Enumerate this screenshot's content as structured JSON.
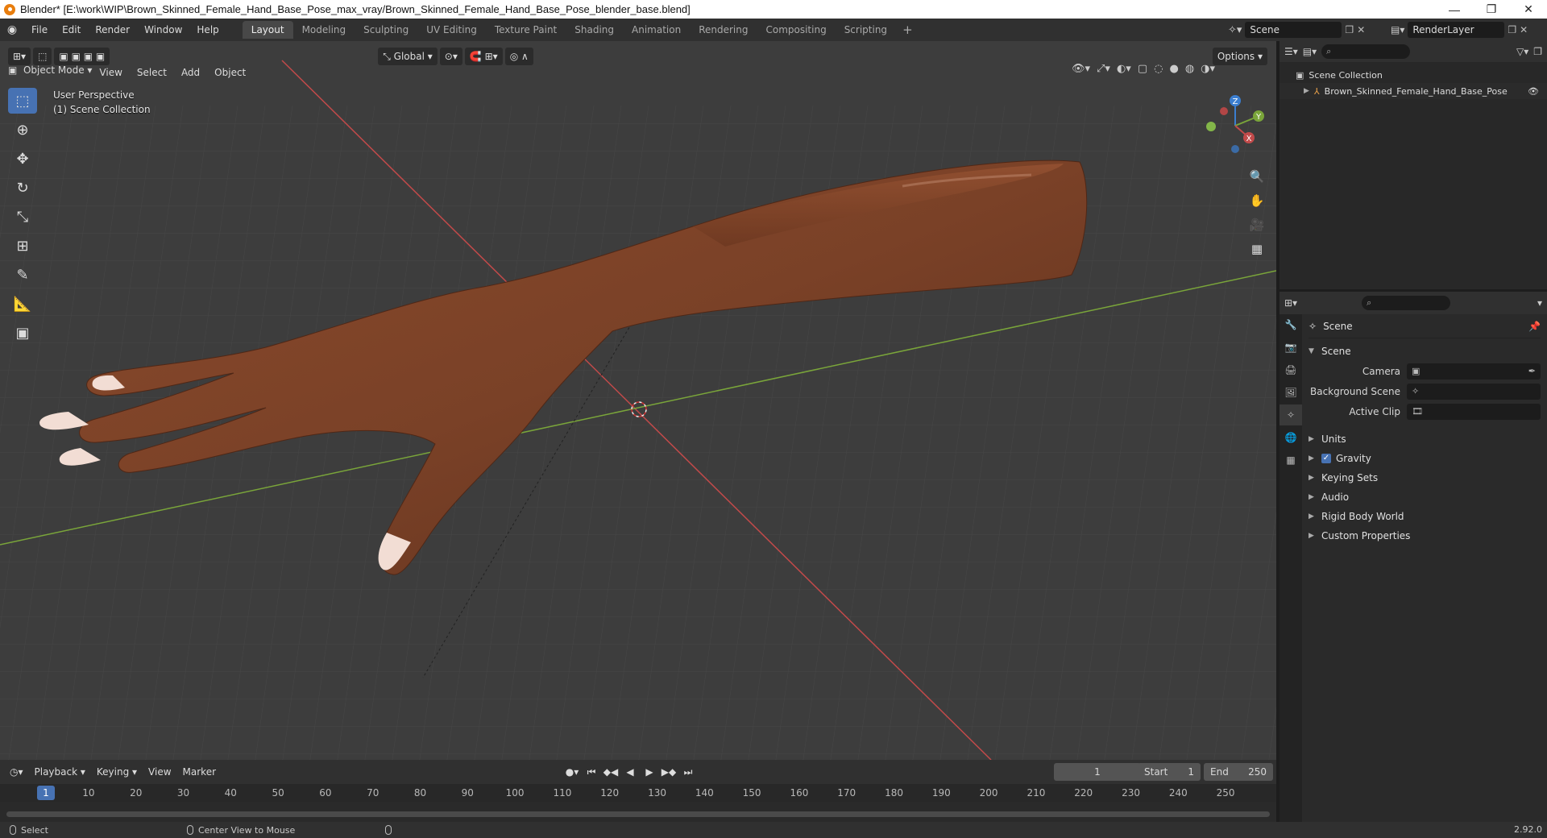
{
  "window": {
    "title": "Blender* [E:\\work\\WIP\\Brown_Skinned_Female_Hand_Base_Pose_max_vray/Brown_Skinned_Female_Hand_Base_Pose_blender_base.blend]",
    "controls": [
      "—",
      "❐",
      "✕"
    ]
  },
  "menu": [
    "File",
    "Edit",
    "Render",
    "Window",
    "Help"
  ],
  "workspaces": [
    {
      "label": "Layout",
      "active": true
    },
    {
      "label": "Modeling"
    },
    {
      "label": "Sculpting"
    },
    {
      "label": "UV Editing"
    },
    {
      "label": "Texture Paint"
    },
    {
      "label": "Shading"
    },
    {
      "label": "Animation"
    },
    {
      "label": "Rendering"
    },
    {
      "label": "Compositing"
    },
    {
      "label": "Scripting"
    }
  ],
  "scene_name": "Scene",
  "render_layer": "RenderLayer",
  "viewport": {
    "mode": "Object Mode",
    "menus": [
      "View",
      "Select",
      "Add",
      "Object"
    ],
    "transform_orientation": "Global",
    "options_label": "Options",
    "perspective_label": "User Perspective",
    "collection_label": "(1) Scene Collection",
    "gizmo_axes": [
      "X",
      "Y",
      "Z"
    ],
    "colors": {
      "background": "#3d3d3d",
      "x_axis": "#c24a4a",
      "y_axis": "#7aa53a",
      "skin": "#7a4127",
      "nail": "#f2ddd4"
    }
  },
  "timeline": {
    "menus": [
      "Playback",
      "Keying",
      "View",
      "Marker"
    ],
    "current_frame": "1",
    "start_label": "Start",
    "start": "1",
    "end_label": "End",
    "end": "250",
    "ticks": [
      "10",
      "20",
      "30",
      "40",
      "50",
      "60",
      "70",
      "80",
      "90",
      "100",
      "110",
      "120",
      "130",
      "140",
      "150",
      "160",
      "170",
      "180",
      "190",
      "200",
      "210",
      "220",
      "230",
      "240",
      "250"
    ]
  },
  "statusbar": {
    "select": "Select",
    "center_view": "Center View to Mouse",
    "version": "2.92.0"
  },
  "outliner": {
    "root": "Scene Collection",
    "child": "Brown_Skinned_Female_Hand_Base_Pose"
  },
  "properties": {
    "context": "Scene",
    "panel": "Scene",
    "fields": [
      {
        "label": "Camera"
      },
      {
        "label": "Background Scene"
      },
      {
        "label": "Active Clip"
      }
    ],
    "subpanels": [
      {
        "label": "Units"
      },
      {
        "label": "Gravity",
        "checked": true
      },
      {
        "label": "Keying Sets"
      },
      {
        "label": "Audio"
      },
      {
        "label": "Rigid Body World"
      },
      {
        "label": "Custom Properties"
      }
    ]
  }
}
